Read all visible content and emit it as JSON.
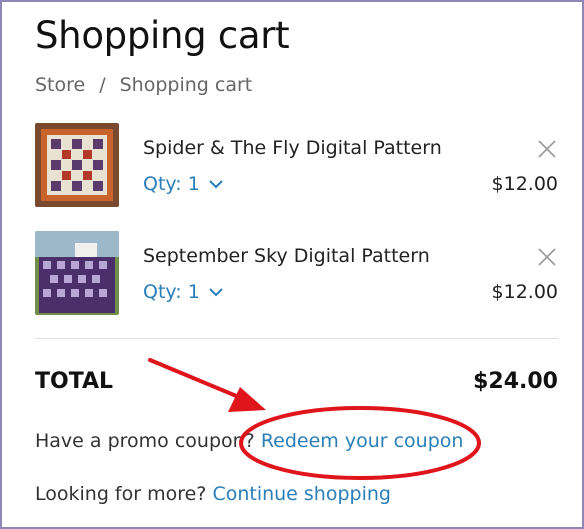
{
  "page": {
    "title": "Shopping cart"
  },
  "breadcrumb": {
    "store": "Store",
    "separator": "/",
    "current": "Shopping cart"
  },
  "items": [
    {
      "name": "Spider & The Fly Digital Pattern",
      "qty_label": "Qty: 1",
      "price": "$12.00"
    },
    {
      "name": "September Sky Digital Pattern",
      "qty_label": "Qty: 1",
      "price": "$12.00"
    }
  ],
  "summary": {
    "total_label": "TOTAL",
    "total_value": "$24.00"
  },
  "promo": {
    "prompt": "Have a promo coupon?",
    "link": "Redeem your coupon"
  },
  "more": {
    "prompt": "Looking for more?",
    "link": "Continue shopping"
  },
  "colors": {
    "link": "#2a7fb8",
    "annotation": "#e0141b",
    "frame": "#8d86b8"
  },
  "icons": {
    "remove": "close-icon",
    "qty": "chevron-down-icon"
  }
}
